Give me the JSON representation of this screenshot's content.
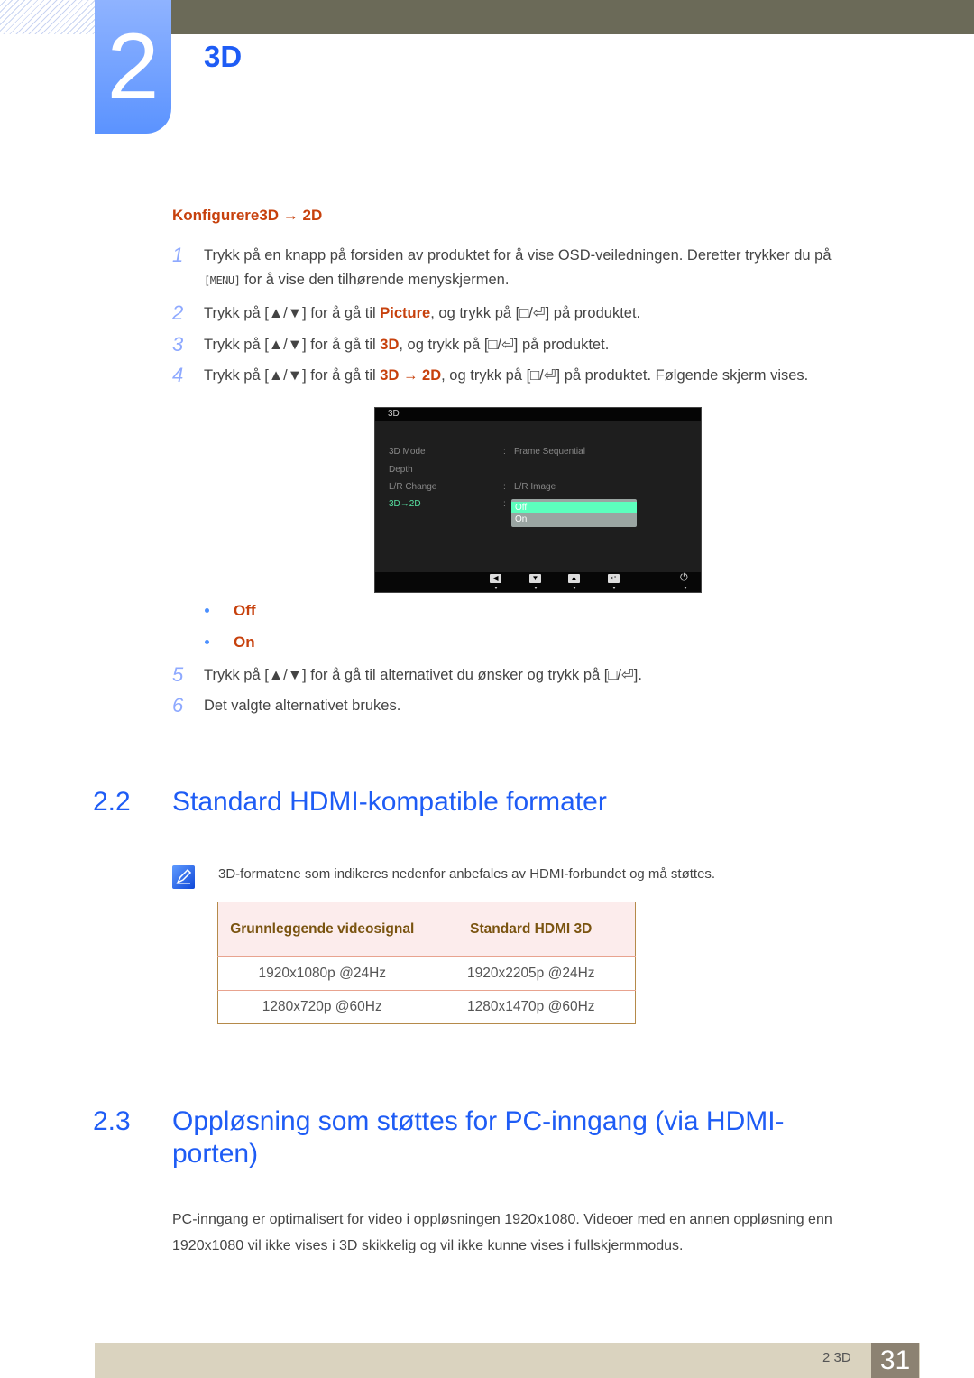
{
  "chapter": {
    "number": "2",
    "title": "3D"
  },
  "section_configure": {
    "heading": "Konfigurere3D → 2D",
    "steps": [
      {
        "num": "1",
        "line1": "Trykk på en knapp på forsiden av produktet for å vise OSD-veiledningen. Deretter trykker du på",
        "menu_key": "[MENU]",
        "line2": " for å vise den tilhørende menyskjermen."
      },
      {
        "num": "2",
        "pre": "Trykk på [▲/▼] for å gå til ",
        "hl": "Picture",
        "post": ", og trykk på [□/⏎] på produktet."
      },
      {
        "num": "3",
        "pre": "Trykk på [▲/▼] for å gå til ",
        "hl": "3D",
        "post": ", og trykk på [□/⏎] på produktet."
      },
      {
        "num": "4",
        "pre": "Trykk på [▲/▼] for å gå til ",
        "hl": "3D →  2D",
        "post": ", og trykk på [□/⏎] på produktet. Følgende skjerm vises."
      },
      {
        "num": "5",
        "text": "Trykk på [▲/▼] for å gå til alternativet du ønsker og trykk på [□/⏎]."
      },
      {
        "num": "6",
        "text": "Det valgte alternativet brukes."
      }
    ],
    "options": [
      "Off",
      "On"
    ]
  },
  "osd": {
    "title": "3D",
    "rows": [
      {
        "label": "3D Mode",
        "value": "Frame Sequential"
      },
      {
        "label": "Depth",
        "value": ""
      },
      {
        "label": "L/R Change",
        "value": "L/R Image"
      },
      {
        "label": "3D→2D",
        "value": ""
      }
    ],
    "colon": ":",
    "dropdown": {
      "options": [
        "Off",
        "On"
      ],
      "selected": "Off"
    },
    "buttons": [
      {
        "icon": "left-icon",
        "glyph": "◀"
      },
      {
        "icon": "down-icon",
        "glyph": "▼"
      },
      {
        "icon": "up-icon",
        "glyph": "▲"
      },
      {
        "icon": "enter-icon",
        "glyph": "↵"
      },
      {
        "icon": "power-icon",
        "glyph": "⏻"
      }
    ],
    "colors": {
      "active": "#58e3a3",
      "selected_bg": "#5cffbd"
    }
  },
  "section_22": {
    "number": "2.2",
    "title": "Standard HDMI-kompatible formater",
    "note": "3D-formatene som indikeres nedenfor anbefales av HDMI-forbundet og må støttes.",
    "table": {
      "headers": [
        "Grunnleggende videosignal",
        "Standard HDMI 3D"
      ],
      "rows": [
        [
          "1920x1080p @24Hz",
          "1920x2205p @24Hz"
        ],
        [
          "1280x720p @60Hz",
          "1280x1470p @60Hz"
        ]
      ]
    }
  },
  "section_23": {
    "number": "2.3",
    "title_line1": "Oppløsning som støttes for PC-inngang (via HDMI-",
    "title_line2": "porten)",
    "para_line1": "PC-inngang er optimalisert for video i oppløsningen 1920x1080. Videoer med en annen oppløsning enn",
    "para_line2": "1920x1080 vil ikke vises i 3D skikkelig og vil ikke kunne vises i fullskjermmodus."
  },
  "footer": {
    "label": "2 3D",
    "page": "31"
  }
}
